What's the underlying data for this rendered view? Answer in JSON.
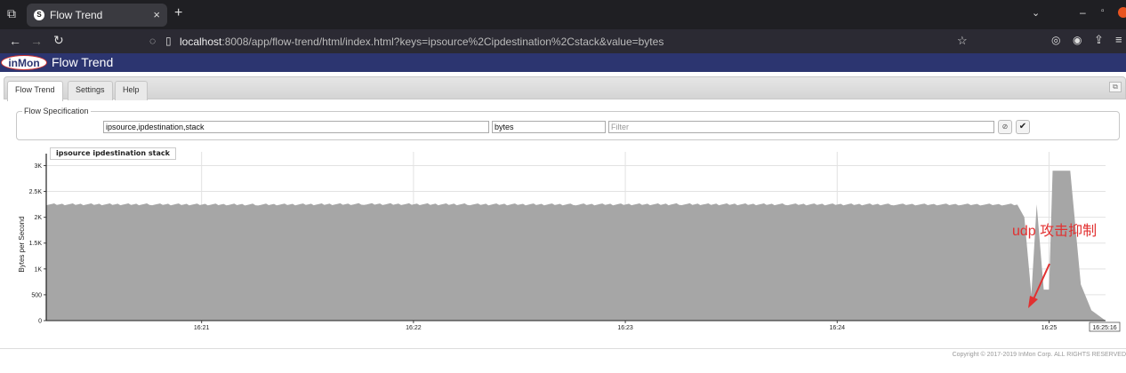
{
  "browser": {
    "tab_title": "Flow Trend",
    "tab_close": "×",
    "new_tab": "+",
    "url_host": "localhost",
    "url_rest": ":8008/app/flow-trend/html/index.html?keys=ipsource%2Cipdestination%2Cstack&value=bytes"
  },
  "app": {
    "logo_text": "inMon",
    "title": "Flow Trend"
  },
  "tabs": [
    {
      "label": "Flow Trend",
      "active": true
    },
    {
      "label": "Settings",
      "active": false
    },
    {
      "label": "Help",
      "active": false
    }
  ],
  "flow_spec": {
    "legend": "Flow Specification",
    "keys_value": "ipsource,ipdestination,stack",
    "value_value": "bytes",
    "filter_placeholder": "Filter"
  },
  "chart_data": {
    "type": "area",
    "legend_label": "ipsource ipdestination stack",
    "ylabel": "Bytes per Second",
    "ylim": [
      0,
      3300
    ],
    "yticks": [
      0,
      500,
      1000,
      1500,
      2000,
      2500,
      3000
    ],
    "ytick_labels": [
      "0",
      "500",
      "1K",
      "1.5K",
      "2K",
      "2.5K",
      "3K"
    ],
    "xtick_labels": [
      "16:21",
      "16:22",
      "16:23",
      "16:24",
      "16:25"
    ],
    "xend_label": "16:25:16",
    "fill_color": "#a6a6a6",
    "grid": true,
    "time_range_sec": [
      0,
      300
    ],
    "series": [
      {
        "points": [
          [
            0,
            2250
          ],
          [
            30,
            2250
          ],
          [
            60,
            2245
          ],
          [
            90,
            2255
          ],
          [
            120,
            2250
          ],
          [
            150,
            2248
          ],
          [
            180,
            2252
          ],
          [
            210,
            2250
          ],
          [
            240,
            2248
          ],
          [
            275,
            2245
          ],
          [
            277,
            2000
          ],
          [
            279,
            500
          ],
          [
            280.5,
            2250
          ],
          [
            282.5,
            600
          ],
          [
            284,
            600
          ],
          [
            285,
            2900
          ],
          [
            290,
            2900
          ],
          [
            293,
            700
          ],
          [
            296,
            200
          ],
          [
            300,
            0
          ]
        ]
      }
    ]
  },
  "annotation": "udp 攻击抑制",
  "footer": "Copyright © 2017-2019 InMon Corp. ALL RIGHTS RESERVED"
}
